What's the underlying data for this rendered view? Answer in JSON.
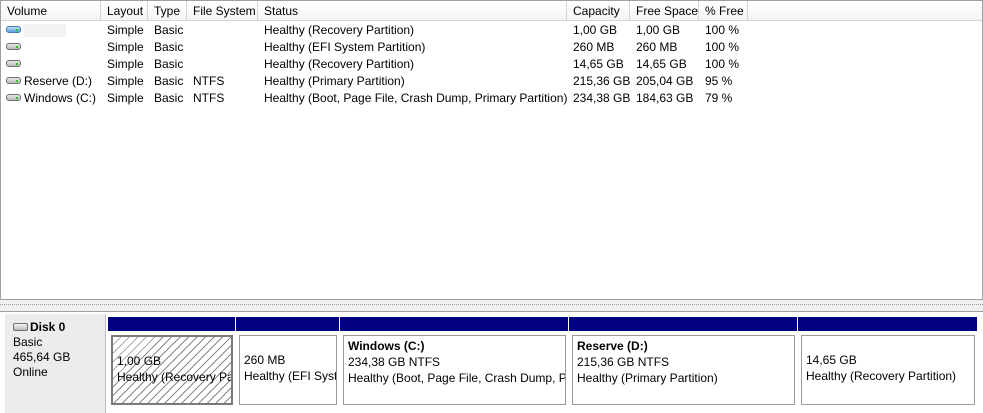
{
  "columns": [
    "Volume",
    "Layout",
    "Type",
    "File System",
    "Status",
    "Capacity",
    "Free Space",
    "% Free"
  ],
  "volumes": [
    {
      "icon": "blue-volume-icon",
      "name": "",
      "layout": "Simple",
      "type": "Basic",
      "fs": "",
      "status": "Healthy (Recovery Partition)",
      "capacity": "1,00 GB",
      "free": "1,00 GB",
      "pct": "100 %"
    },
    {
      "icon": "volume-icon",
      "name": "",
      "layout": "Simple",
      "type": "Basic",
      "fs": "",
      "status": "Healthy (EFI System Partition)",
      "capacity": "260 MB",
      "free": "260 MB",
      "pct": "100 %"
    },
    {
      "icon": "volume-icon",
      "name": "",
      "layout": "Simple",
      "type": "Basic",
      "fs": "",
      "status": "Healthy (Recovery Partition)",
      "capacity": "14,65 GB",
      "free": "14,65 GB",
      "pct": "100 %"
    },
    {
      "icon": "volume-icon",
      "name": "Reserve (D:)",
      "layout": "Simple",
      "type": "Basic",
      "fs": "NTFS",
      "status": "Healthy (Primary Partition)",
      "capacity": "215,36 GB",
      "free": "205,04 GB",
      "pct": "95 %"
    },
    {
      "icon": "volume-icon",
      "name": "Windows (C:)",
      "layout": "Simple",
      "type": "Basic",
      "fs": "NTFS",
      "status": "Healthy (Boot, Page File, Crash Dump, Primary Partition)",
      "capacity": "234,38 GB",
      "free": "184,63 GB",
      "pct": "79 %"
    }
  ],
  "disk": {
    "icon": "disk-icon",
    "name": "Disk 0",
    "type": "Basic",
    "size": "465,64 GB",
    "state": "Online"
  },
  "partitions": [
    {
      "title": "",
      "size": "1,00 GB",
      "status": "Healthy (Recovery Pa",
      "selected": true
    },
    {
      "title": "",
      "size": "260 MB",
      "status": "Healthy (EFI Syst",
      "selected": false
    },
    {
      "title": "Windows  (C:)",
      "size": "234,38 GB NTFS",
      "status": "Healthy (Boot, Page File, Crash Dump, Pr",
      "selected": false
    },
    {
      "title": "Reserve  (D:)",
      "size": "215,36 GB NTFS",
      "status": "Healthy (Primary Partition)",
      "selected": false
    },
    {
      "title": "",
      "size": "14,65 GB",
      "status": "Healthy (Recovery Partition)",
      "selected": false
    }
  ],
  "colors": {
    "partition_bar": "#000080"
  }
}
